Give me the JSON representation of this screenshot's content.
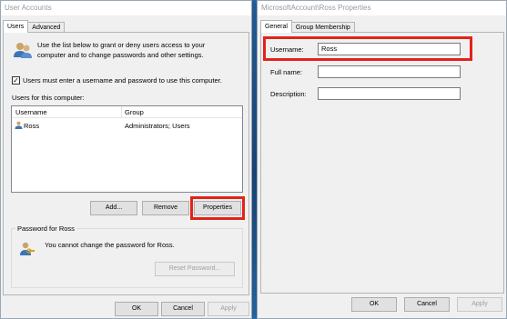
{
  "left_window": {
    "title": "User Accounts",
    "tabs": [
      "Users",
      "Advanced"
    ],
    "intro_text_line1": "Use the list below to grant or deny users access to your",
    "intro_text_line2": "computer and to change passwords and other settings.",
    "must_enter_checkbox": {
      "label": "Users must enter a username and password to use this computer.",
      "checked": true
    },
    "users_label": "Users for this computer:",
    "table": {
      "columns": [
        "Username",
        "Group"
      ],
      "rows": [
        {
          "username": "Ross",
          "group": "Administrators; Users"
        }
      ]
    },
    "buttons": {
      "add": "Add...",
      "remove": "Remove",
      "properties": "Properties"
    },
    "password_group": {
      "title": "Password for Ross",
      "text": "You cannot change the password for Ross.",
      "reset_button": "Reset Password..."
    },
    "footer": {
      "ok": "OK",
      "cancel": "Cancel",
      "apply": "Apply"
    }
  },
  "right_window": {
    "title": "MicrosoftAccount\\Ross Properties",
    "tabs": [
      "General",
      "Group Membership"
    ],
    "fields": {
      "username_label": "Username:",
      "username_value": "Ross",
      "fullname_label": "Full name:",
      "fullname_value": "",
      "description_label": "Description:",
      "description_value": ""
    },
    "footer": {
      "ok": "OK",
      "cancel": "Cancel",
      "apply": "Apply"
    }
  },
  "highlight_color": "#e2231a"
}
